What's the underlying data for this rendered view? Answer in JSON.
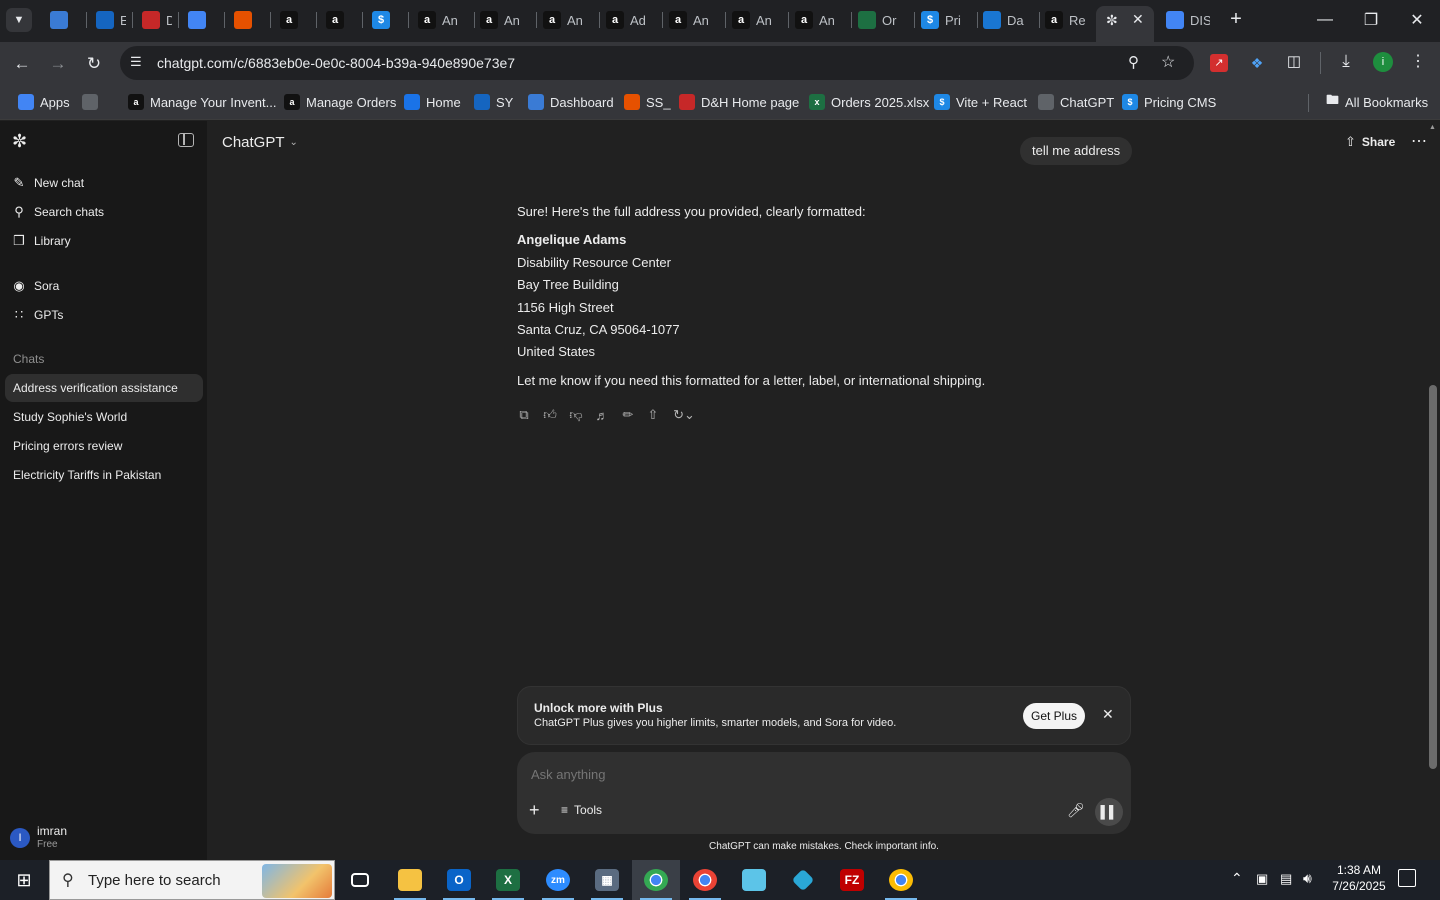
{
  "browser": {
    "tabs": [
      {
        "icon": "kite-icon",
        "label": "",
        "color": "#3a7bd5"
      },
      {
        "icon": "ec-icon",
        "label": "EC",
        "color": "#1565c0"
      },
      {
        "icon": "dnh-icon",
        "label": "D&H",
        "color": "#c62828"
      },
      {
        "icon": "google-icon",
        "label": "",
        "color": "#4285f4"
      },
      {
        "icon": "stack-icon",
        "label": "",
        "color": "#e65100"
      },
      {
        "icon": "amazon-icon",
        "label": "a",
        "color": "#111111"
      },
      {
        "icon": "amazon-icon",
        "label": "a",
        "color": "#111111"
      },
      {
        "icon": "dollar-icon",
        "label": "$",
        "color": "#1e88e5"
      },
      {
        "icon": "amazon-icon",
        "label": "An",
        "color": "#111111"
      },
      {
        "icon": "amazon-icon",
        "label": "An",
        "color": "#111111"
      },
      {
        "icon": "amazon-icon",
        "label": "An",
        "color": "#111111"
      },
      {
        "icon": "amazon-icon",
        "label": "Ad",
        "color": "#111111"
      },
      {
        "icon": "amazon-icon",
        "label": "An",
        "color": "#111111"
      },
      {
        "icon": "amazon-icon",
        "label": "An",
        "color": "#111111"
      },
      {
        "icon": "amazon-icon",
        "label": "An",
        "color": "#111111"
      },
      {
        "icon": "excel-icon",
        "label": "Or",
        "color": "#1d6f42"
      },
      {
        "icon": "dollar-icon",
        "label": "Pri",
        "color": "#1e88e5"
      },
      {
        "icon": "dashboard-icon",
        "label": "Da",
        "color": "#1976d2"
      },
      {
        "icon": "amazon-icon",
        "label": "Re",
        "color": "#111111"
      },
      {
        "icon": "chatgpt-icon",
        "label": "",
        "color": "#35363a"
      },
      {
        "icon": "google-icon",
        "label": "DIS",
        "color": "#4285f4"
      }
    ],
    "url": "chatgpt.com/c/6883eb0e-0e0c-8004-b39a-940e890e73e7",
    "bookmarks": [
      {
        "label": "Apps",
        "icon": "apps-grid-icon",
        "color": "#4285f4"
      },
      {
        "label": "",
        "icon": "tab-groups-icon",
        "color": "#5f6368"
      },
      {
        "label": "Manage Your Invent...",
        "icon": "amazon-icon",
        "color": "#111111"
      },
      {
        "label": "Manage Orders",
        "icon": "amazon-icon",
        "color": "#111111"
      },
      {
        "label": "Home",
        "icon": "home-site-icon",
        "color": "#1a73e8"
      },
      {
        "label": "SY",
        "icon": "ec-icon",
        "color": "#1565c0"
      },
      {
        "label": "Dashboard",
        "icon": "kite-icon",
        "color": "#3a7bd5"
      },
      {
        "label": "SS_",
        "icon": "stack-icon",
        "color": "#e65100"
      },
      {
        "label": "D&H Home page",
        "icon": "dnh-icon",
        "color": "#c62828"
      },
      {
        "label": "Orders 2025.xlsx",
        "icon": "excel-icon",
        "color": "#1d6f42"
      },
      {
        "label": "Vite + React",
        "icon": "dollar-icon",
        "color": "#1e88e5"
      },
      {
        "label": "ChatGPT",
        "icon": "chatgpt-icon",
        "color": "#5f6368"
      },
      {
        "label": "Pricing CMS",
        "icon": "dollar-icon",
        "color": "#1e88e5"
      }
    ],
    "all_bookmarks": "All Bookmarks",
    "profile_initial": "i"
  },
  "sidebar": {
    "nav": [
      {
        "label": "New chat",
        "icon": "new-chat-icon"
      },
      {
        "label": "Search chats",
        "icon": "search-icon"
      },
      {
        "label": "Library",
        "icon": "library-icon"
      },
      {
        "label": "Sora",
        "icon": "sora-icon"
      },
      {
        "label": "GPTs",
        "icon": "gpts-icon"
      }
    ],
    "chats_heading": "Chats",
    "chats": [
      {
        "label": "Address verification assistance",
        "active": true
      },
      {
        "label": "Study Sophie's World",
        "active": false
      },
      {
        "label": "Pricing errors review",
        "active": false
      },
      {
        "label": "Electricity Tariffs in Pakistan",
        "active": false
      }
    ],
    "user": {
      "initial": "I",
      "name": "imran",
      "plan": "Free"
    }
  },
  "header": {
    "model": "ChatGPT",
    "share": "Share"
  },
  "conversation": {
    "user_message": "tell me address",
    "assistant": {
      "intro": "Sure! Here's the full address you provided, clearly formatted:",
      "name": "Angelique Adams",
      "address_lines": [
        "Disability Resource Center",
        "Bay Tree Building",
        "1156 High Street",
        "Santa Cruz, CA 95064-1077",
        "United States"
      ],
      "outro": "Let me know if you need this formatted for a letter, label, or international shipping."
    }
  },
  "upsell": {
    "title": "Unlock more with Plus",
    "body": "ChatGPT Plus gives you higher limits, smarter models, and Sora for video.",
    "button": "Get Plus"
  },
  "composer": {
    "placeholder": "Ask anything",
    "tools": "Tools",
    "disclaimer": "ChatGPT can make mistakes. Check important info."
  },
  "taskbar": {
    "search_placeholder": "Type here to search",
    "time": "1:38 AM",
    "date": "7/26/2025"
  }
}
